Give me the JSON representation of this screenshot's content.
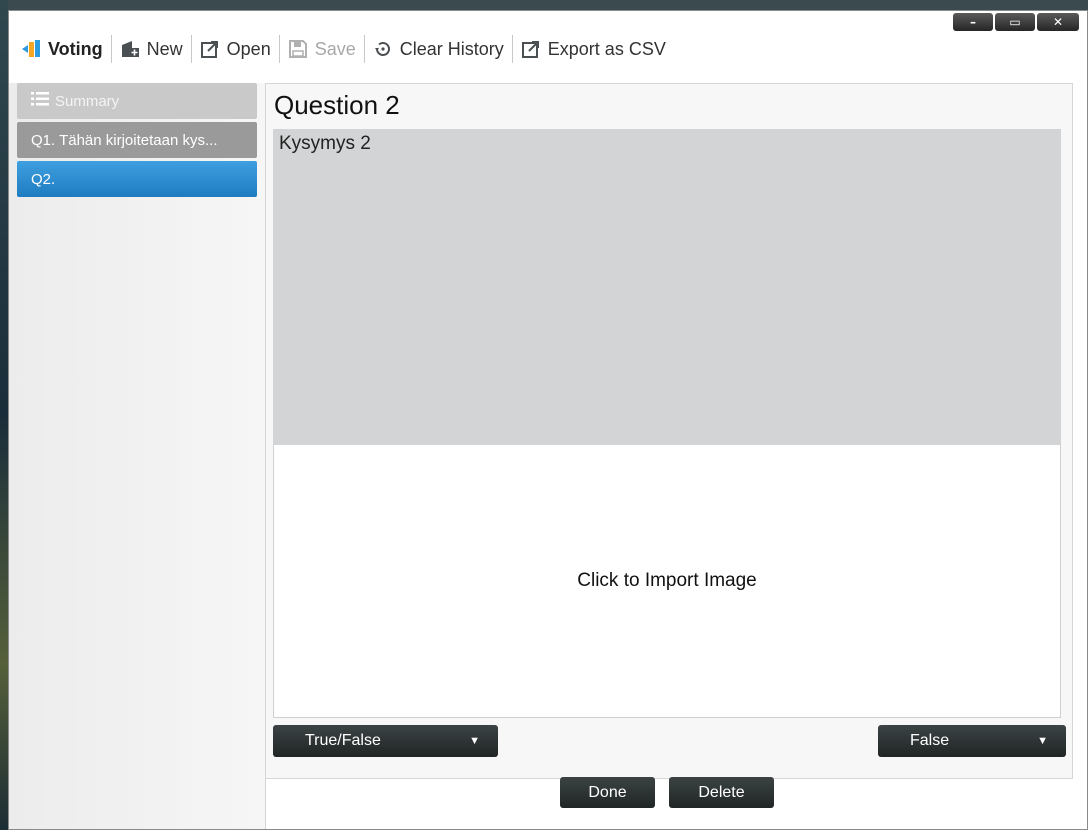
{
  "window": {
    "controls": {
      "minimize": "–",
      "maximize": "▭",
      "close": "✕"
    }
  },
  "toolbar": {
    "brand": "Voting",
    "new_label": "New",
    "open_label": "Open",
    "save_label": "Save",
    "clear_history_label": "Clear History",
    "export_label": "Export as CSV"
  },
  "sidebar": {
    "items": [
      {
        "label": "Summary",
        "icon": "list-icon"
      },
      {
        "label": "Q1. Tähän kirjoitetaan kys..."
      },
      {
        "label": "Q2."
      }
    ]
  },
  "main": {
    "title": "Question 2",
    "question_text": "Kysymys 2",
    "image_placeholder": "Click to Import Image",
    "type_dropdown": "True/False",
    "answer_dropdown": "False",
    "dropdown_arrow": "▼"
  },
  "footer": {
    "done_label": "Done",
    "delete_label": "Delete"
  },
  "colors": {
    "selected_item": "#1e7cc0",
    "button_dark": "#262b2c",
    "question_bg": "#d3d4d5"
  }
}
